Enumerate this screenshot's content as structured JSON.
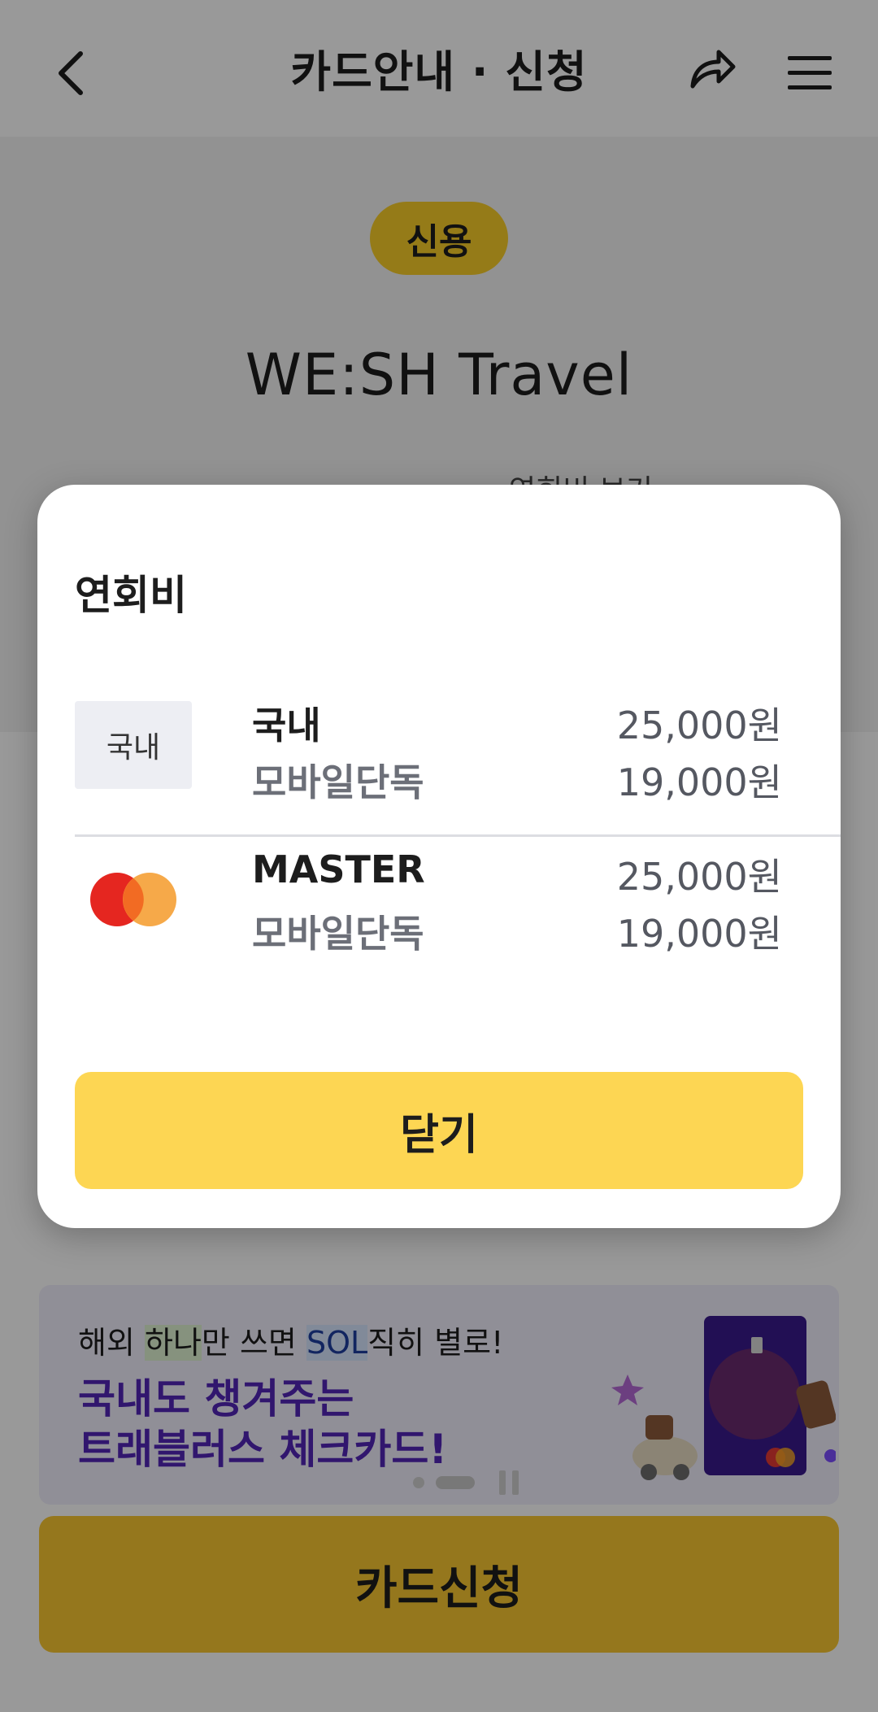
{
  "header": {
    "title": "카드안내 · 신청"
  },
  "hero": {
    "badge": "신용",
    "card_name": "WE:SH Travel",
    "fee_link": "연회비 보기 ›"
  },
  "promo": {
    "line1_pre": "해외 ",
    "line1_hl1": "하나",
    "line1_mid": "만 쓰면 ",
    "line1_hl2": "SOL",
    "line1_post": "직히 별로!",
    "line2": "국내도 챙겨주는",
    "line3": "트래블러스 체크카드!"
  },
  "apply_button": "카드신청",
  "modal": {
    "title": "연회비",
    "rows": [
      {
        "brand_label": "국내",
        "label": "국내",
        "fee": "25,000원",
        "sub_label": "모바일단독",
        "sub_fee": "19,000원"
      },
      {
        "brand_icon": "mastercard-logo-icon",
        "label": "MASTER",
        "fee": "25,000원",
        "sub_label": "모바일단독",
        "sub_fee": "19,000원"
      }
    ],
    "close_label": "닫기"
  },
  "colors": {
    "accent_yellow": "#fdd653",
    "promo_purple": "#5225b8",
    "dim_overlay": "rgba(0,0,0,0.40)"
  }
}
